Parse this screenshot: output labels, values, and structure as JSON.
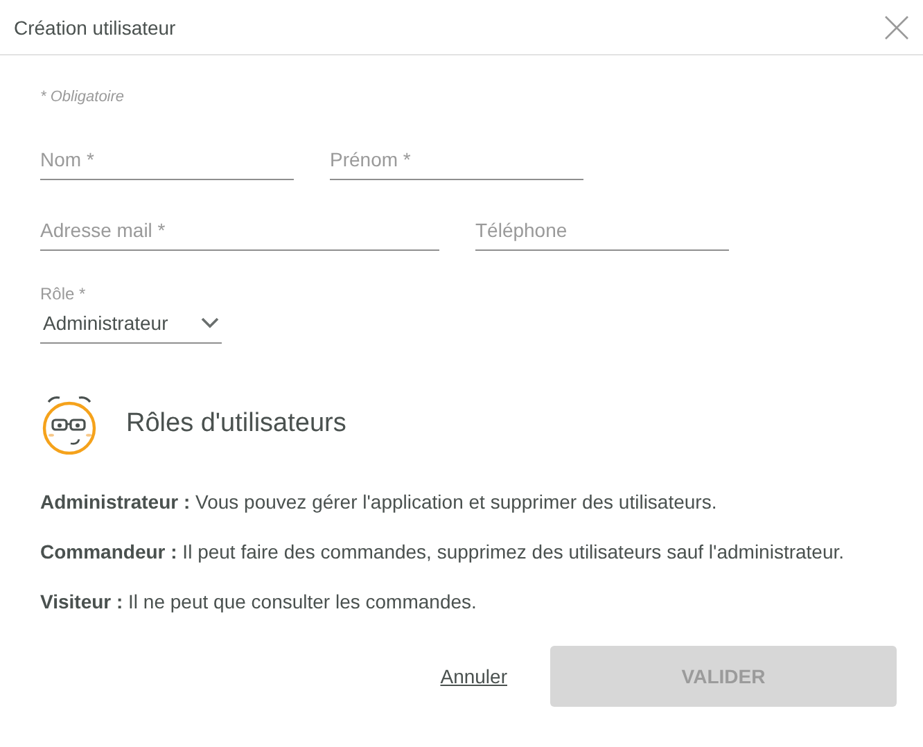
{
  "window": {
    "title": "Création utilisateur"
  },
  "required_note": "* Obligatoire",
  "field_rows": [
    [
      {
        "placeholder": "Nom *",
        "kind": "standard"
      },
      {
        "placeholder": "Prénom *",
        "kind": "standard"
      }
    ],
    [
      {
        "placeholder": "Adresse mail *",
        "kind": "wide"
      },
      {
        "placeholder": "Téléphone",
        "kind": "standard"
      }
    ]
  ],
  "role_select": {
    "label": "Rôle *",
    "value": "Administrateur"
  },
  "roles_section": {
    "title": "Rôles d'utilisateurs",
    "descriptions": [
      "**Administrateur :** Vous pouvez gérer l'application et supprimer des utilisateurs.",
      "**Commandeur :** Il peut faire des commandes, supprimez des utilisateurs sauf l'administrateur.",
      "**Visiteur :** Il ne peut que consulter les commandes."
    ]
  },
  "buttons": {
    "cancel": "Annuler",
    "submit": {
      "label": "VALIDER",
      "disabled": true
    }
  }
}
